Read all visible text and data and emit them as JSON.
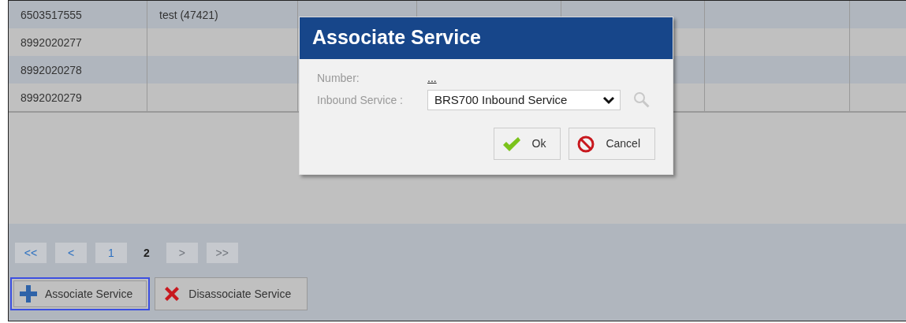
{
  "table": {
    "rows": [
      {
        "selected": false,
        "cells": [
          "6503517555",
          "test (47421)"
        ]
      },
      {
        "selected": false,
        "cells": [
          "8992020277"
        ]
      },
      {
        "selected": false,
        "cells": [
          "8992020278"
        ]
      },
      {
        "selected": false,
        "cells": [
          "8992020279"
        ]
      }
    ]
  },
  "pager": [
    {
      "label": "<<",
      "selected": false,
      "disabled": false
    },
    {
      "label": "<",
      "selected": false,
      "disabled": false
    },
    {
      "label": "1",
      "selected": false,
      "disabled": false
    },
    {
      "label": "2",
      "selected": true,
      "disabled": false
    },
    {
      "label": ">",
      "selected": false,
      "disabled": true
    },
    {
      "label": ">>",
      "selected": false,
      "disabled": true
    }
  ],
  "actions": [
    {
      "label": "Associate Service",
      "focused": true
    },
    {
      "label": "Disassociate Service",
      "focused": false
    }
  ],
  "dialog": {
    "title": "Associate Service",
    "number": {
      "label": "Number:",
      "value": "..."
    },
    "inbound_service": {
      "label": "Inbound Service :",
      "value": "BRS700 Inbound Service"
    },
    "buttons": [
      {
        "label": "Ok"
      },
      {
        "label": "Cancel"
      }
    ]
  }
}
